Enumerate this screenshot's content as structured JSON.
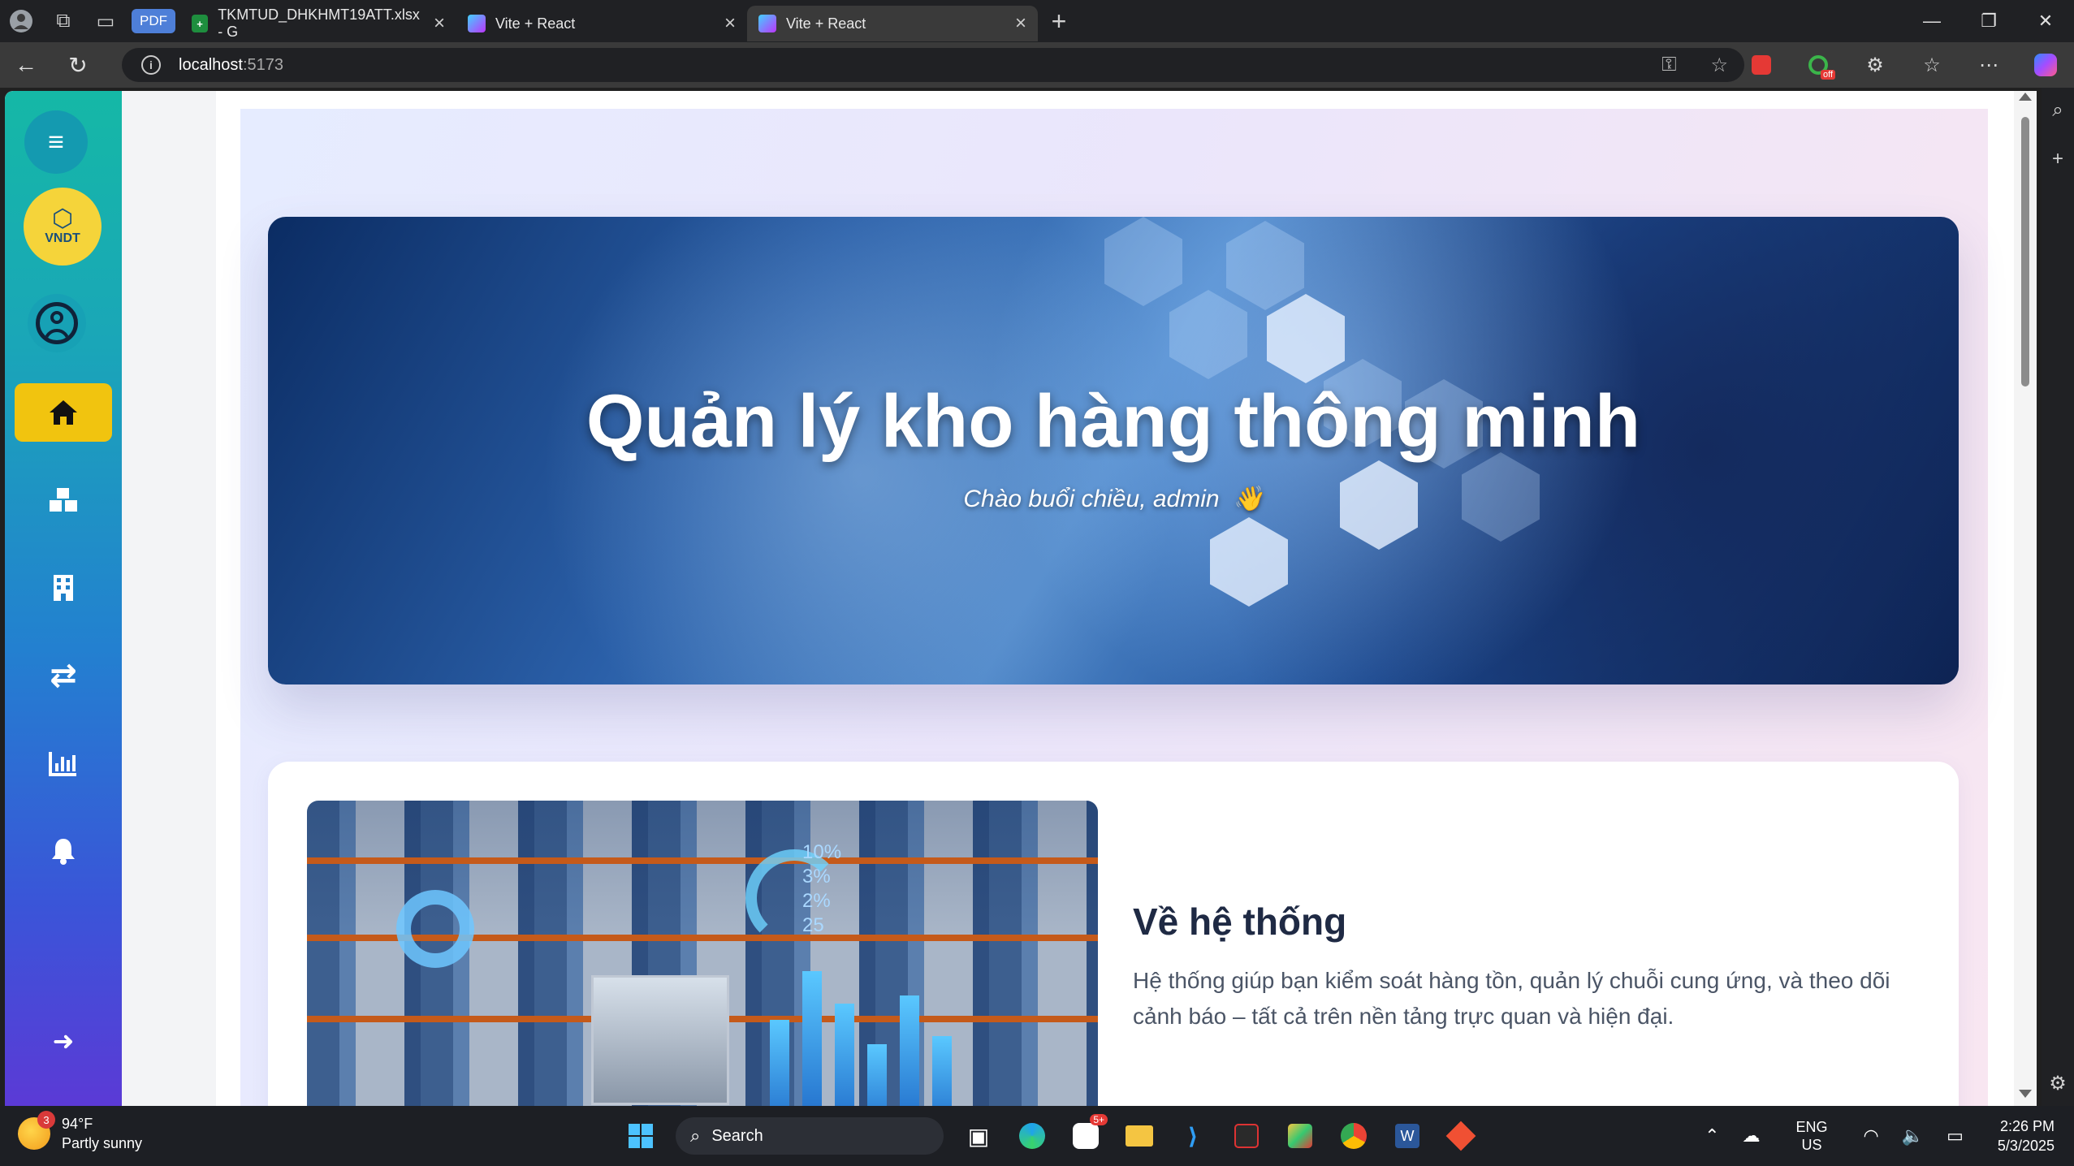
{
  "browser": {
    "tabs": [
      {
        "label": "TKMTUD_DHKHMT19ATT.xlsx - G",
        "favicon": "sheets-icon"
      },
      {
        "label": "Vite + React",
        "favicon": "vite-icon"
      },
      {
        "label": "Vite + React",
        "favicon": "vite-icon",
        "active": true
      }
    ],
    "pdf_chip": "PDF",
    "address": {
      "host": "localhost",
      "port": ":5173"
    },
    "extension_badge": "off"
  },
  "sidebar": {
    "logo_text": "VNDT",
    "items": [
      {
        "icon": "home-icon",
        "active": true
      },
      {
        "icon": "boxes-icon"
      },
      {
        "icon": "building-icon"
      },
      {
        "icon": "transfer-icon"
      },
      {
        "icon": "chart-icon"
      },
      {
        "icon": "bell-icon"
      }
    ],
    "logout_icon": "logout-icon"
  },
  "hero": {
    "title": "Quản lý kho hàng thông minh",
    "subtitle": "Chào buổi chiều, admin",
    "wave": "👋"
  },
  "about": {
    "title": "Về hệ thống",
    "text": "Hệ thống giúp bạn kiểm soát hàng tồn, quản lý chuỗi cung ứng, và theo dõi cảnh báo – tất cả trên nền tảng trực quan và hiện đại."
  },
  "image_overlay": {
    "percents": [
      "10%",
      "3%",
      "2%",
      "25"
    ]
  },
  "taskbar": {
    "weather": {
      "temp": "94°F",
      "desc": "Partly sunny",
      "badge": "3"
    },
    "search_placeholder": "Search",
    "zalo_badge": "5+",
    "lang_top": "ENG",
    "lang_bottom": "US",
    "time": "2:26 PM",
    "date": "5/3/2025"
  },
  "colors": {
    "sidebar_active": "#f1c40f",
    "sidebar_top": "#15b8a6",
    "sidebar_bottom": "#5b3ad6",
    "heading": "#1f2a44"
  }
}
